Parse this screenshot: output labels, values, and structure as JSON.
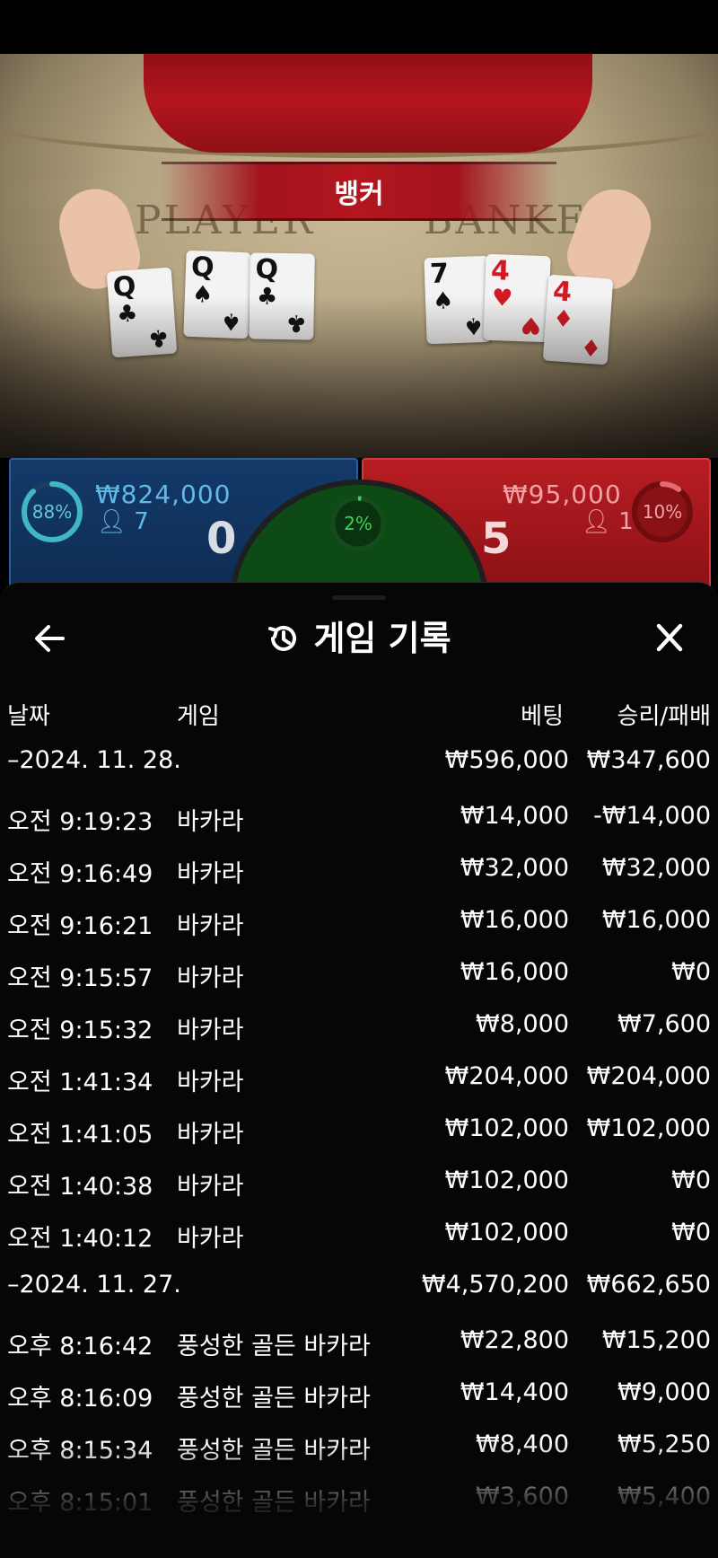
{
  "scene": {
    "banner": "뱅커",
    "player_word": "PLAYER",
    "banker_word": "BANKER",
    "player_cards": [
      {
        "rank": "Q",
        "suit": "♣",
        "color": "black"
      },
      {
        "rank": "Q",
        "suit": "♠",
        "color": "black"
      },
      {
        "rank": "Q",
        "suit": "♣",
        "color": "black"
      }
    ],
    "banker_cards": [
      {
        "rank": "7",
        "suit": "♠",
        "color": "black"
      },
      {
        "rank": "4",
        "suit": "♥",
        "color": "red"
      },
      {
        "rank": "4",
        "suit": "♦",
        "color": "red"
      }
    ]
  },
  "bet_panel": {
    "player": {
      "percent": "88%",
      "amount": "₩824,000",
      "people": "7",
      "score": "0",
      "fill": 0.88,
      "color": "#3fb7c4"
    },
    "tie": {
      "percent": "2%",
      "fill": 0.02,
      "color": "#3fd157"
    },
    "banker": {
      "percent": "10%",
      "amount": "₩95,000",
      "people": "1",
      "score": "5",
      "fill": 0.1,
      "color": "#e46a6e"
    }
  },
  "history": {
    "title": "게임 기록",
    "columns": {
      "date": "날짜",
      "game": "게임",
      "bet": "베팅",
      "result": "승리/패배"
    },
    "groups": [
      {
        "date": "–2024. 11. 28.",
        "bet": "₩596,000",
        "result": "₩347,600",
        "rows": [
          {
            "time": "오전 9:19:23",
            "game": "바카라",
            "bet": "₩14,000",
            "result": "-₩14,000"
          },
          {
            "time": "오전 9:16:49",
            "game": "바카라",
            "bet": "₩32,000",
            "result": "₩32,000"
          },
          {
            "time": "오전 9:16:21",
            "game": "바카라",
            "bet": "₩16,000",
            "result": "₩16,000"
          },
          {
            "time": "오전 9:15:57",
            "game": "바카라",
            "bet": "₩16,000",
            "result": "₩0"
          },
          {
            "time": "오전 9:15:32",
            "game": "바카라",
            "bet": "₩8,000",
            "result": "₩7,600"
          },
          {
            "time": "오전 1:41:34",
            "game": "바카라",
            "bet": "₩204,000",
            "result": "₩204,000"
          },
          {
            "time": "오전 1:41:05",
            "game": "바카라",
            "bet": "₩102,000",
            "result": "₩102,000"
          },
          {
            "time": "오전 1:40:38",
            "game": "바카라",
            "bet": "₩102,000",
            "result": "₩0"
          },
          {
            "time": "오전 1:40:12",
            "game": "바카라",
            "bet": "₩102,000",
            "result": "₩0"
          }
        ]
      },
      {
        "date": "–2024. 11. 27.",
        "bet": "₩4,570,200",
        "result": "₩662,650",
        "rows": [
          {
            "time": "오후 8:16:42",
            "game": "풍성한 골든 바카라",
            "bet": "₩22,800",
            "result": "₩15,200"
          },
          {
            "time": "오후 8:16:09",
            "game": "풍성한 골든 바카라",
            "bet": "₩14,400",
            "result": "₩9,000"
          },
          {
            "time": "오후 8:15:34",
            "game": "풍성한 골든 바카라",
            "bet": "₩8,400",
            "result": "₩5,250"
          },
          {
            "time": "오후 8:15:01",
            "game": "풍성한 골든 바카라",
            "bet": "₩3,600",
            "result": "₩5,400"
          }
        ]
      }
    ]
  }
}
